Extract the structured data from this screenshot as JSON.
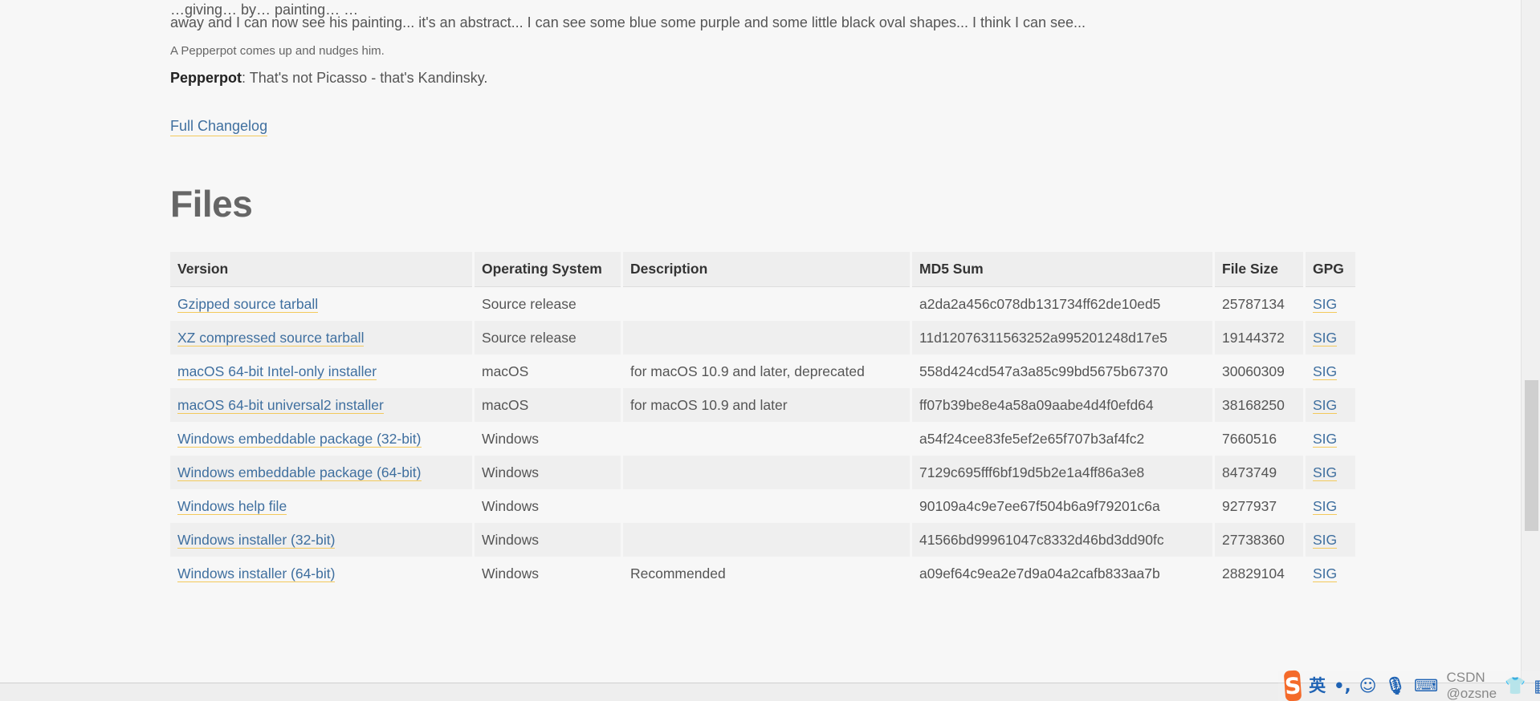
{
  "story": {
    "line_top": "…giving… by… painting… …",
    "line_second": "away and I can now see his painting... it's an abstract... I can see some blue some purple and some little black oval shapes... I think I can see...",
    "stage_direction": "A Pepperpot comes up and nudges him.",
    "speaker": "Pepperpot",
    "speech": ": That's not Picasso - that's Kandinsky."
  },
  "changelog_link": "Full Changelog",
  "files": {
    "title": "Files",
    "headers": [
      "Version",
      "Operating System",
      "Description",
      "MD5 Sum",
      "File Size",
      "GPG"
    ],
    "rows": [
      {
        "version": "Gzipped source tarball",
        "os": "Source release",
        "description": "",
        "md5": "a2da2a456c078db131734ff62de10ed5",
        "size": "25787134",
        "gpg": "SIG"
      },
      {
        "version": "XZ compressed source tarball",
        "os": "Source release",
        "description": "",
        "md5": "11d12076311563252a995201248d17e5",
        "size": "19144372",
        "gpg": "SIG"
      },
      {
        "version": "macOS 64-bit Intel-only installer",
        "os": "macOS",
        "description": "for macOS 10.9 and later, deprecated",
        "md5": "558d424cd547a3a85c99bd5675b67370",
        "size": "30060309",
        "gpg": "SIG"
      },
      {
        "version": "macOS 64-bit universal2 installer",
        "os": "macOS",
        "description": "for macOS 10.9 and later",
        "md5": "ff07b39be8e4a58a09aabe4d4f0efd64",
        "size": "38168250",
        "gpg": "SIG"
      },
      {
        "version": "Windows embeddable package (32-bit)",
        "os": "Windows",
        "description": "",
        "md5": "a54f24cee83fe5ef2e65f707b3af4fc2",
        "size": "7660516",
        "gpg": "SIG"
      },
      {
        "version": "Windows embeddable package (64-bit)",
        "os": "Windows",
        "description": "",
        "md5": "7129c695fff6bf19d5b2e1a4ff86a3e8",
        "size": "8473749",
        "gpg": "SIG"
      },
      {
        "version": "Windows help file",
        "os": "Windows",
        "description": "",
        "md5": "90109a4c9e7ee67f504b6a9f79201c6a",
        "size": "9277937",
        "gpg": "SIG"
      },
      {
        "version": "Windows installer (32-bit)",
        "os": "Windows",
        "description": "",
        "md5": "41566bd99961047c8332d46bd3dd90fc",
        "size": "27738360",
        "gpg": "SIG"
      },
      {
        "version": "Windows installer (64-bit)",
        "os": "Windows",
        "description": "Recommended",
        "md5": "a09ef64c9ea2e7d9a04a2cafb833aa7b",
        "size": "28829104",
        "gpg": "SIG"
      }
    ]
  },
  "ime": {
    "logo": "S",
    "mode": "英",
    "punct": "•,",
    "watermark": "CSDN @ozsne"
  }
}
